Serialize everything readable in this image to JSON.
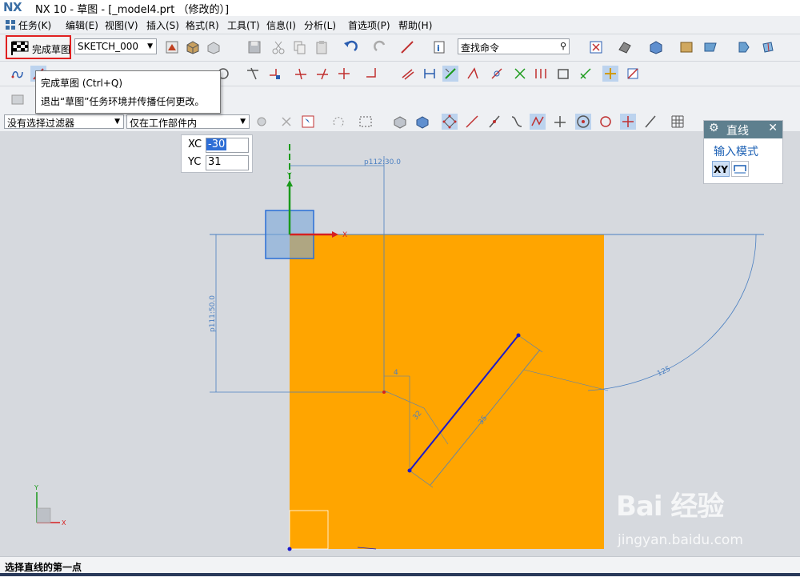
{
  "window": {
    "logo": "NX",
    "title": "NX 10 - 草图 - [_model4.prt （修改的）]"
  },
  "menu": [
    {
      "label": "任务(K)"
    },
    {
      "label": "编辑(E)"
    },
    {
      "label": "视图(V)"
    },
    {
      "label": "插入(S)"
    },
    {
      "label": "格式(R)"
    },
    {
      "label": "工具(T)"
    },
    {
      "label": "信息(I)"
    },
    {
      "label": "分析(L)"
    },
    {
      "label": "首选项(P)"
    },
    {
      "label": "帮助(H)"
    }
  ],
  "toolbar": {
    "finish_sketch_label": "完成草图",
    "sketch_name": "SKETCH_000",
    "find_command_placeholder": "查找命令"
  },
  "tooltip": {
    "title": "完成草图 (Ctrl+Q)",
    "description": "退出“草图”任务环境并传播任何更改。"
  },
  "selection_bar": {
    "filter": "没有选择过滤器",
    "scope": "仅在工作部件内"
  },
  "dynamic_input": {
    "xc_label": "XC",
    "xc_value": "-30",
    "yc_label": "YC",
    "yc_value": "31"
  },
  "line_panel": {
    "title": "直线",
    "input_mode_label": "输入模式",
    "xy_label": "XY"
  },
  "sketch": {
    "dimension_horizontal": "p112:30.0",
    "dimension_vertical": "p111:50.0",
    "dimension_arc": "125",
    "dimension_line_length": "35",
    "dimension_small_1": "4",
    "dimension_small_2": "32",
    "axis_x_label": "X",
    "axis_y_label": "Y",
    "colors": {
      "fill": "#ffa500",
      "constraint_line": "#4a7fc1",
      "selected_line": "#1a1acc",
      "x_axis": "#d62020",
      "y_axis": "#1a9a1a"
    }
  },
  "status": {
    "prompt": "选择直线的第一点"
  },
  "watermark": {
    "brand": "Bai 经验",
    "url": "jingyan.baidu.com"
  }
}
